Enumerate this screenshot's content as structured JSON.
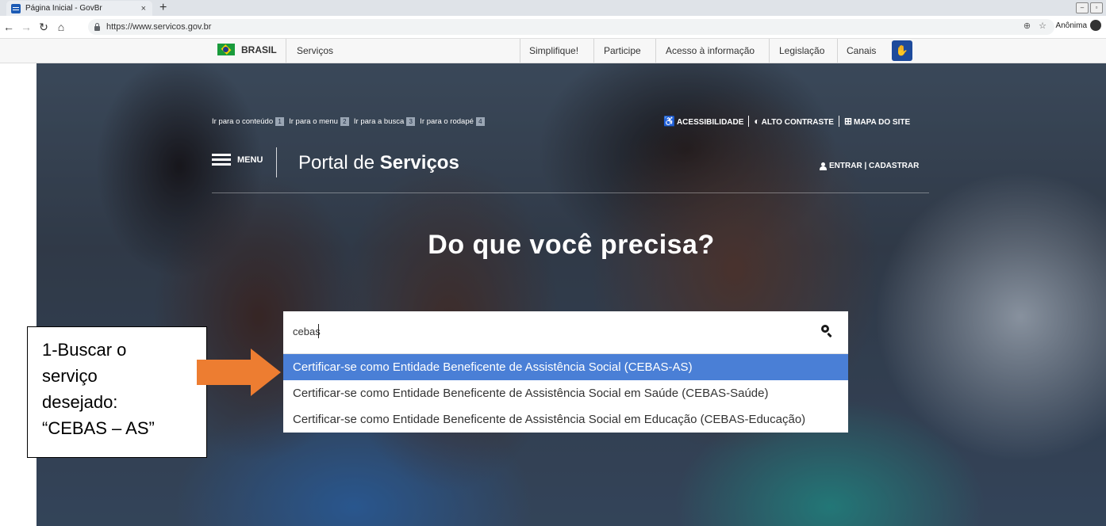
{
  "browser": {
    "tab_title": "Página Inicial - GovBr",
    "tab_close": "×",
    "new_tab": "+",
    "url": "https://www.servicos.gov.br",
    "profile_label": "Anônima"
  },
  "govbar": {
    "brand": "BRASIL",
    "left_link": "Serviços",
    "links": [
      "Simplifique!",
      "Participe",
      "Acesso à informação",
      "Legislação",
      "Canais"
    ]
  },
  "header": {
    "skip_links": [
      {
        "label": "Ir para o conteúdo",
        "key": "1"
      },
      {
        "label": "Ir para o menu",
        "key": "2"
      },
      {
        "label": "Ir para a busca",
        "key": "3"
      },
      {
        "label": "Ir para o rodapé",
        "key": "4"
      }
    ],
    "accessibility": "ACESSIBILIDADE",
    "high_contrast": "ALTO CONTRASTE",
    "sitemap": "MAPA DO SITE",
    "menu_label": "MENU",
    "portal_title_prefix": "Portal de ",
    "portal_title_bold": "Serviços",
    "login": "ENTRAR | CADASTRAR"
  },
  "hero": {
    "headline": "Do que você precisa?"
  },
  "search": {
    "value": "cebas",
    "suggestions": [
      "Certificar-se como Entidade Beneficente de Assistência Social (CEBAS-AS)",
      "Certificar-se como Entidade Beneficente de Assistência Social em Saúde (CEBAS-Saúde)",
      "Certificar-se como Entidade Beneficente de Assistência Social em Educação (CEBAS-Educação)"
    ],
    "active_index": 0
  },
  "annotation": {
    "lines": [
      "1-Buscar o",
      "serviço",
      "desejado:",
      "“CEBAS – AS”"
    ],
    "arrow_color": "#ed7d31"
  }
}
